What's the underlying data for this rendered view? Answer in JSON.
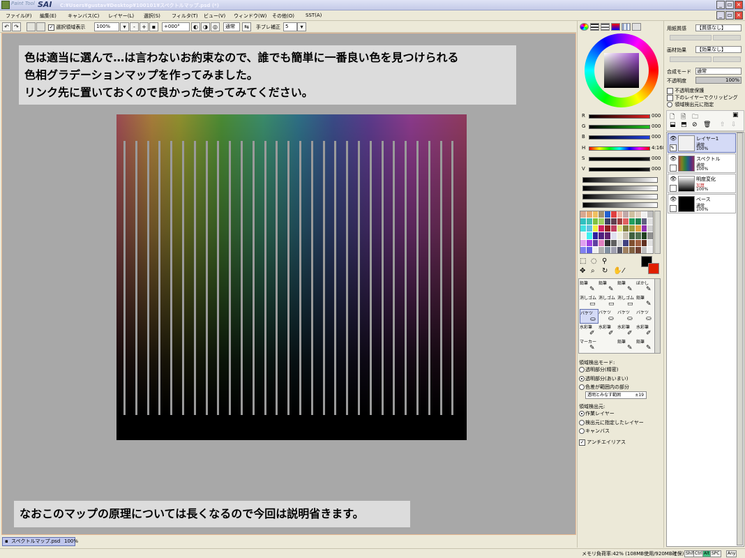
{
  "window": {
    "app_name_small": "Paint Tool",
    "app_name": "SAI",
    "title": "C:¥Users¥gustav¥Desktop¥100101¥スペクトルマップ.psd (*)",
    "buttons": {
      "minimize": "_",
      "restore": "▭",
      "close": "×"
    }
  },
  "menu": [
    "ファイル(F)",
    "編集(E)",
    "キャンバス(C)",
    "レイヤー(L)",
    "選択(S)",
    "フィルタ(T)",
    "ビュー(V)",
    "ウィンドウ(W)",
    "その他(O)",
    "SST(A)"
  ],
  "toolbar": {
    "undo": "↶",
    "redo": "↷",
    "selection_label": "選択領域表示",
    "zoom": "100%",
    "zoom_minus": "-",
    "zoom_plus": "+",
    "zoom_reset": "▪",
    "rotation": "+000°",
    "blend_mode": "通常",
    "stabilizer_label": "手ブレ補正",
    "stabilizer_value": "5"
  },
  "canvas": {
    "note_top": [
      "色は適当に選んで…は言わないお約束なので、誰でも簡単に一番良い色を見つけられる",
      "色相グラデーションマップを作ってみました。",
      "リンク先に置いておくので良かった使ってみてください。"
    ],
    "note_bottom": "なおこのマップの原理については長くなるので今回は説明省きます。"
  },
  "document_tab": {
    "name": "スペクトルマップ.psd",
    "zoom": "100%"
  },
  "status": {
    "memory": "メモリ負荷率:42% (108MB使用/920MB確保)",
    "keys": [
      "Shift",
      "Ctrl",
      "Alt",
      "SPC",
      "Any"
    ]
  },
  "color_panel": {
    "sliders": [
      {
        "label": "R",
        "value": "000",
        "color": "#e02020"
      },
      {
        "label": "G",
        "value": "000",
        "color": "#20c020"
      },
      {
        "label": "B",
        "value": "000",
        "color": "#2040e0"
      },
      {
        "label": "H",
        "value": "4:168",
        "color": "hue"
      },
      {
        "label": "S",
        "value": "000",
        "color": "#000000"
      },
      {
        "label": "V",
        "value": "000",
        "color": "#000000"
      }
    ],
    "swatches": [
      "#d8a890",
      "#e8a870",
      "#f0c060",
      "#a09070",
      "#2060d0",
      "#e04040",
      "#f0b0a0",
      "#c0a8a8",
      "#d0c0a0",
      "#e0d0c0",
      "#f0f0f0",
      "#c0c0c0",
      "#30c0c0",
      "#40c0b0",
      "#80c040",
      "#a0d060",
      "#404060",
      "#604050",
      "#a04040",
      "#e06060",
      "#20a060",
      "#208050",
      "#606080",
      "#e0e0e0",
      "#40e0e0",
      "#60c0e0",
      "#f0f040",
      "#d02060",
      "#902020",
      "#c04060",
      "#e0e080",
      "#808040",
      "#a0a040",
      "#e0a040",
      "#9030b0",
      "#d0d0d0",
      "#f0f0f0",
      "#40f0f0",
      "#3020a0",
      "#502080",
      "#602070",
      "#e0e0f0",
      "#f0f0e0",
      "#c8c0b0",
      "#406040",
      "#507050",
      "#204020",
      "#909090",
      "#e0a0f0",
      "#a040e0",
      "#6040a0",
      "#e080c0",
      "#303030",
      "#606060",
      "#d0d0d0",
      "#404080",
      "#805030",
      "#a06040",
      "#603020",
      "#e0e0e0",
      "#8080f0",
      "#6060e0",
      "#f0f0f0",
      "#b0b0b0",
      "#8090a0",
      "#a0a0b0",
      "#505060",
      "#a08060",
      "#806040",
      "#704030",
      "#c0c0c0",
      "#f0f0f0"
    ],
    "brush_rows": [
      [
        "鉛筆",
        "鉛筆",
        "鉛筆",
        "ぼかし"
      ],
      [
        "消しゴム",
        "消しゴム",
        "消しゴム",
        "鉛筆"
      ],
      [
        "バケツ",
        "バケツ",
        "バケツ",
        "バケツ"
      ],
      [
        "水彩筆",
        "水彩筆",
        "水彩筆",
        "水彩筆"
      ],
      [
        "マーカー",
        "",
        "鉛筆",
        "鉛筆"
      ]
    ],
    "detect_mode_label": "領域検出モード:",
    "detect_modes": [
      "透明部分(精密)",
      "透明部分(あいまい)",
      "色差が範囲内の部分"
    ],
    "detect_mode_selected": 1,
    "range_label": "透明とみなす範囲",
    "range_value": "±19",
    "detect_source_label": "領域検出元:",
    "detect_sources": [
      "作業レイヤー",
      "検出元に指定したレイヤー",
      "キャンバス"
    ],
    "detect_source_selected": 0,
    "antialias_label": "アンチエイリアス"
  },
  "layer_panel": {
    "paper_texture_label": "用紙質感",
    "paper_texture_value": "【質感なし】",
    "paper_effect_label": "画材効果",
    "paper_effect_value": "【効果なし】",
    "blend_label": "合成モード",
    "blend_value": "通常",
    "opacity_label": "不透明度",
    "opacity_value": "100%",
    "checks": [
      "不透明度保護",
      "下のレイヤーでクリッピング",
      "領域検出元に指定"
    ],
    "layers": [
      {
        "name": "レイヤー1",
        "mode": "通常",
        "opacity": "100%",
        "selected": true,
        "thumb": "#f0f0f0"
      },
      {
        "name": "スペクトル",
        "mode": "通常",
        "opacity": "100%",
        "selected": false,
        "thumb": "spectrum"
      },
      {
        "name": "明度変化",
        "mode": "加算",
        "opacity": "100%",
        "selected": false,
        "thumb": "gradient"
      },
      {
        "name": "ベース",
        "mode": "通常",
        "opacity": "100%",
        "selected": false,
        "thumb": "#000000"
      }
    ]
  }
}
